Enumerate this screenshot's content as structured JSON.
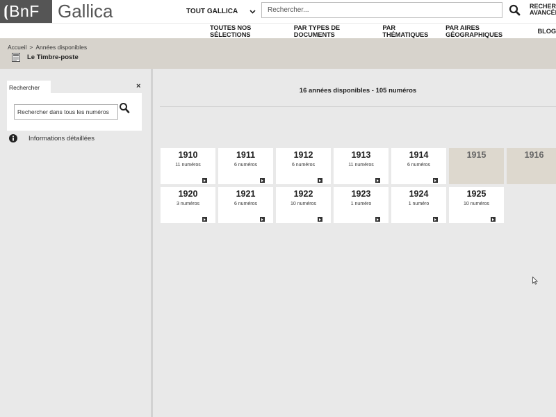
{
  "header": {
    "logo_left": "⦗BnF",
    "logo_right": "Gallica",
    "scope_label": "TOUT GALLICA",
    "search_placeholder": "Rechercher...",
    "advanced_search": "RECHERC\nAVANCÉE"
  },
  "nav": {
    "items": [
      "TOUTES NOS SÉLECTIONS",
      "PAR TYPES DE DOCUMENTS",
      "PAR THÉMATIQUES",
      "PAR AIRES GÉOGRAPHIQUES",
      "BLOG"
    ]
  },
  "breadcrumb": {
    "home": "Accueil",
    "separator": ">",
    "current": "Années disponibles",
    "title": "Le Timbre-poste"
  },
  "sidebar": {
    "search_tab": "Rechercher",
    "close": "×",
    "search_placeholder": "Rechercher dans tous les numéros",
    "info_label": "Informations détaillées"
  },
  "main": {
    "summary": "16 années disponibles - 105 numéros",
    "years": [
      {
        "year": "1910",
        "count": "11 numéros",
        "available": true
      },
      {
        "year": "1911",
        "count": "6 numéros",
        "available": true
      },
      {
        "year": "1912",
        "count": "6 numéros",
        "available": true
      },
      {
        "year": "1913",
        "count": "11 numéros",
        "available": true
      },
      {
        "year": "1914",
        "count": "6 numéros",
        "available": true
      },
      {
        "year": "1915",
        "count": "",
        "available": false
      },
      {
        "year": "1916",
        "count": "",
        "available": false
      },
      {
        "year": "1920",
        "count": "3 numéros",
        "available": true
      },
      {
        "year": "1921",
        "count": "6 numéros",
        "available": true
      },
      {
        "year": "1922",
        "count": "10 numéros",
        "available": true
      },
      {
        "year": "1923",
        "count": "1 numéro",
        "available": true
      },
      {
        "year": "1924",
        "count": "1 numéro",
        "available": true
      },
      {
        "year": "1925",
        "count": "10 numéros",
        "available": true
      }
    ]
  },
  "colors": {
    "logo_bg": "#555555",
    "crumb_bg": "#d7d3cc",
    "page_bg": "#e9e9e9",
    "tile_disabled": "#ddd8ce"
  }
}
